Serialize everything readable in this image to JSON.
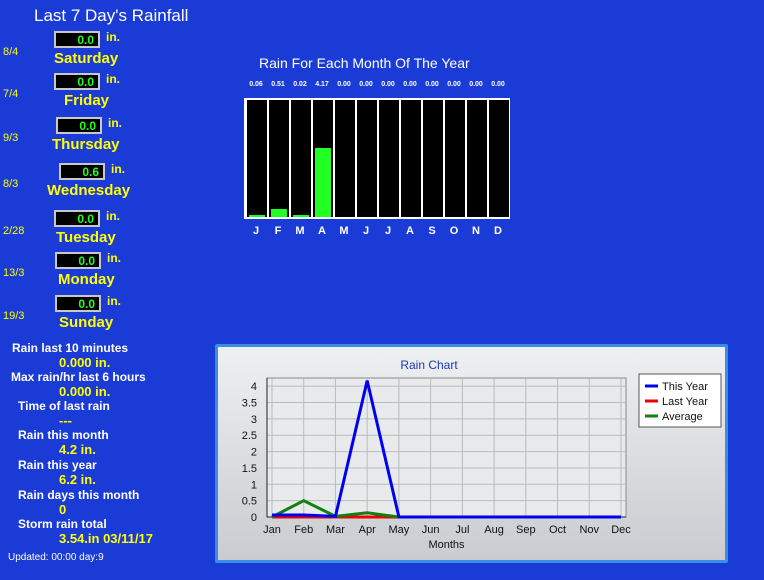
{
  "page_title": "Last 7 Day's Rainfall",
  "unit": "in.",
  "days": [
    {
      "date": "8/4",
      "value": "0.0",
      "name": "Saturday"
    },
    {
      "date": "7/4",
      "value": "0.0",
      "name": "Friday"
    },
    {
      "date": "9/3",
      "value": "0.0",
      "name": "Thursday"
    },
    {
      "date": "8/3",
      "value": "0.6",
      "name": "Wednesday"
    },
    {
      "date": "2/28",
      "value": "0.0",
      "name": "Tuesday"
    },
    {
      "date": "13/3",
      "value": "0.0",
      "name": "Monday"
    },
    {
      "date": "19/3",
      "value": "0.0",
      "name": "Sunday"
    }
  ],
  "stats": [
    {
      "label": "Rain last 10 minutes",
      "value": "0.000 in."
    },
    {
      "label": "Max rain/hr last 6 hours",
      "value": "0.000 in."
    },
    {
      "label": "Time of last rain",
      "value": "---"
    },
    {
      "label": "Rain this month",
      "value": "4.2 in."
    },
    {
      "label": "Rain this year",
      "value": "6.2 in."
    },
    {
      "label": "Rain days this month",
      "value": "0"
    },
    {
      "label": "Storm rain total",
      "value": "3.54.in 03/11/17"
    }
  ],
  "updated": "Updated: 00:00 day:9",
  "month_chart": {
    "title": "Rain For Each Month Of The Year",
    "months": [
      "J",
      "F",
      "M",
      "A",
      "M",
      "J",
      "J",
      "A",
      "S",
      "O",
      "N",
      "D"
    ],
    "value_labels": [
      "0.06",
      "0.51",
      "0.02",
      "4.17",
      "0.00",
      "0.00",
      "0.00",
      "0.00",
      "0.00",
      "0.00",
      "0.00",
      "0.00"
    ],
    "values": [
      0.06,
      0.51,
      0.02,
      4.17,
      0,
      0,
      0,
      0,
      0,
      0,
      0,
      0
    ],
    "max": 7,
    "fill_color": "#22ff22"
  },
  "chart_data": {
    "type": "line",
    "title": "Rain Chart",
    "xlabel": "Months",
    "ylabel": "",
    "categories": [
      "Jan",
      "Feb",
      "Mar",
      "Apr",
      "May",
      "Jun",
      "Jul",
      "Aug",
      "Sep",
      "Oct",
      "Nov",
      "Dec"
    ],
    "ylim": [
      0,
      4.25
    ],
    "y_ticks": [
      "0",
      "0.5",
      "1",
      "1.5",
      "2",
      "2.5",
      "3",
      "3.5",
      "4"
    ],
    "grid": true,
    "legend": "top-right",
    "series": [
      {
        "name": "This Year",
        "color": "#0000ee",
        "values": [
          0.06,
          0.06,
          0.02,
          4.17,
          0,
          0,
          0,
          0,
          0,
          0,
          0,
          0
        ]
      },
      {
        "name": "Last Year",
        "color": "#ee0000",
        "values": [
          0,
          0,
          0,
          0,
          0,
          0,
          0,
          0,
          0,
          0,
          0,
          0
        ]
      },
      {
        "name": "Average",
        "color": "#108010",
        "values": [
          0.0,
          0.5,
          0.02,
          0.13,
          0.0,
          0,
          0,
          0,
          0,
          0,
          0,
          0
        ]
      }
    ]
  }
}
